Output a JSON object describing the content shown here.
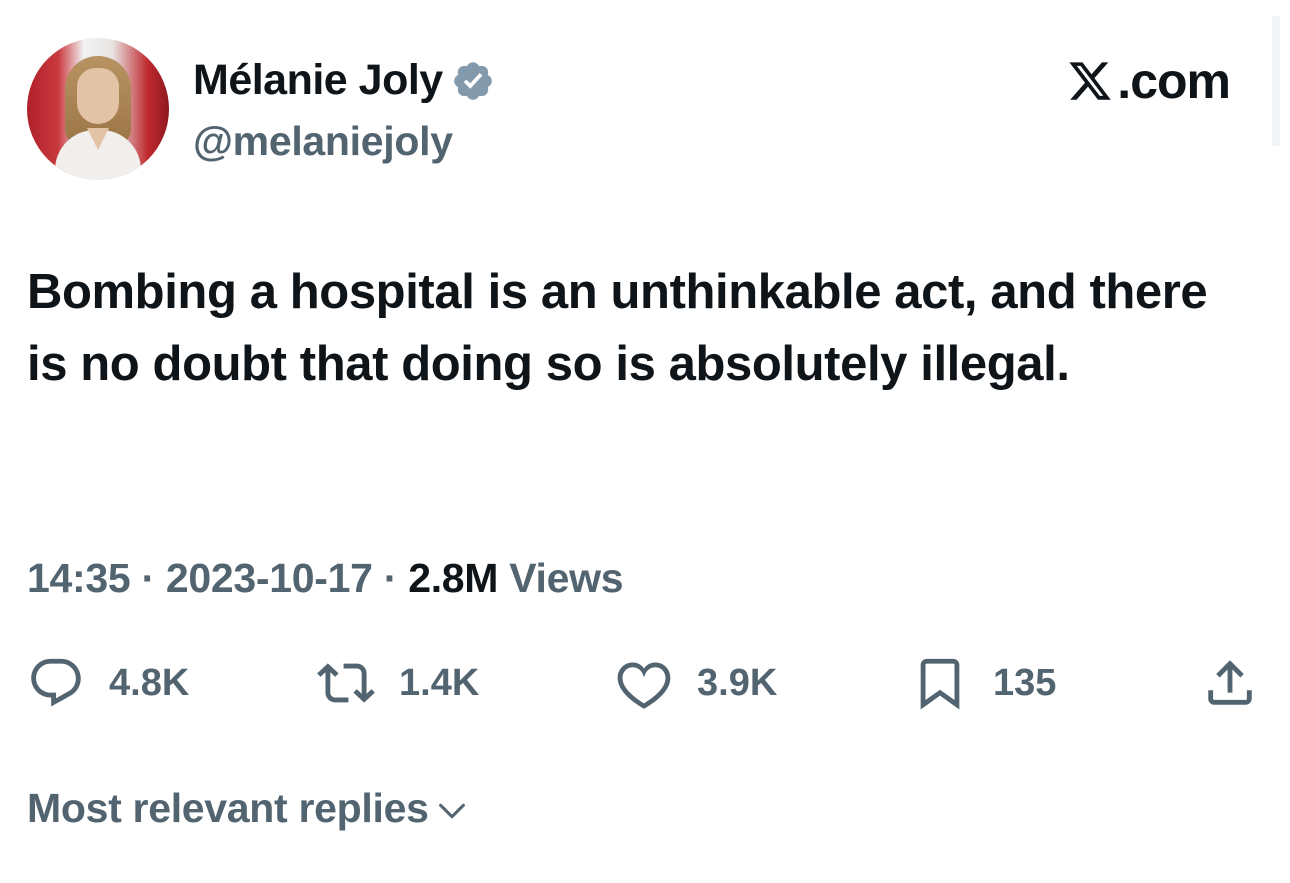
{
  "author": {
    "display_name": "Mélanie Joly",
    "handle": "@melaniejoly",
    "verified": true,
    "avatar_icon": "profile-photo"
  },
  "source": {
    "label": ".com",
    "icon": "x-logo-icon"
  },
  "tweet": {
    "text": "Bombing a hospital is an unthinkable act, and there is no doubt that doing so is absolutely illegal."
  },
  "meta": {
    "time": "14:35",
    "separator": "·",
    "date": "2023-10-17",
    "views_count": "2.8M",
    "views_label": "Views"
  },
  "actions": {
    "replies": "4.8K",
    "reposts": "1.4K",
    "likes": "3.9K",
    "bookmarks": "135"
  },
  "replies_sort": {
    "label": "Most relevant replies"
  },
  "colors": {
    "text_primary": "#0f1419",
    "text_secondary": "#536471",
    "verified_badge": "#829aab"
  }
}
